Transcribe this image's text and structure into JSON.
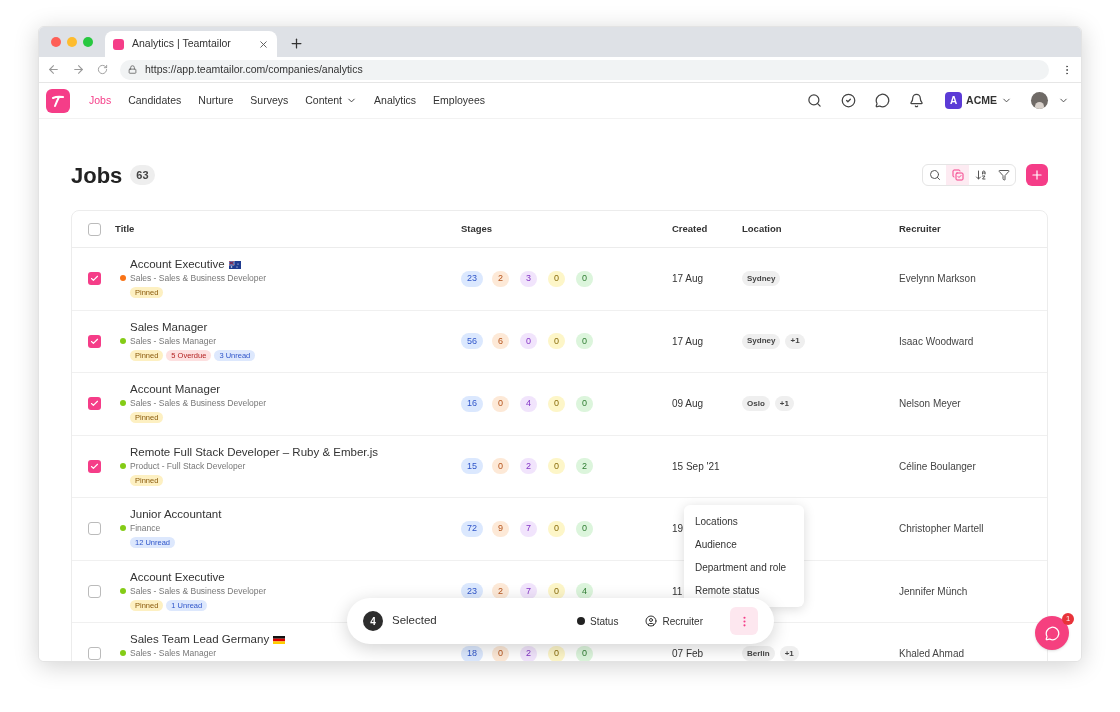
{
  "browser": {
    "tab_title": "Analytics | Teamtailor",
    "url": "https://app.teamtailor.com/companies/analytics"
  },
  "nav": {
    "items": [
      {
        "label": "Jobs",
        "selected": true,
        "dropdown": false
      },
      {
        "label": "Candidates",
        "selected": false,
        "dropdown": false
      },
      {
        "label": "Nurture",
        "selected": false,
        "dropdown": false
      },
      {
        "label": "Surveys",
        "selected": false,
        "dropdown": false
      },
      {
        "label": "Content",
        "selected": false,
        "dropdown": true
      },
      {
        "label": "Analytics",
        "selected": false,
        "dropdown": false
      },
      {
        "label": "Employees",
        "selected": false,
        "dropdown": false
      }
    ],
    "org_initial": "A",
    "org_name": "ACME"
  },
  "page": {
    "title": "Jobs",
    "count": "63"
  },
  "table": {
    "all_selected": false,
    "columns": [
      "Title",
      "Stages",
      "Created",
      "Location",
      "Recruiter"
    ],
    "rows": [
      {
        "checked": true,
        "color": "#f97316",
        "title": "Account Executive",
        "flag": {
          "kind": "au"
        },
        "subtitle": "Sales - Sales & Business Developer",
        "tags": [
          {
            "kind": "pinned",
            "label": "Pinned"
          }
        ],
        "stages": [
          {
            "count": "23",
            "color": "#dbe8fe"
          },
          {
            "count": "2",
            "color": "#fde9d7"
          },
          {
            "count": "3",
            "color": "#f1e4fc"
          },
          {
            "count": "0",
            "color": "#fdf6c8"
          },
          {
            "count": "0",
            "color": "#dcf5dc"
          }
        ],
        "created": "17 Aug",
        "locations": [
          "Sydney"
        ],
        "recruiter": "Evelynn Markson"
      },
      {
        "checked": true,
        "color": "#84cc16",
        "title": "Sales Manager",
        "subtitle": "Sales - Sales Manager",
        "tags": [
          {
            "kind": "pinned",
            "label": "Pinned"
          },
          {
            "kind": "overdue",
            "label": "5 Overdue"
          },
          {
            "kind": "unread",
            "label": "3 Unread"
          }
        ],
        "stages": [
          {
            "count": "56",
            "color": "#dbe8fe"
          },
          {
            "count": "6",
            "color": "#fde9d7"
          },
          {
            "count": "0",
            "color": "#f1e4fc"
          },
          {
            "count": "0",
            "color": "#fdf6c8"
          },
          {
            "count": "0",
            "color": "#dcf5dc"
          }
        ],
        "created": "17 Aug",
        "locations": [
          "Sydney",
          "+1"
        ],
        "recruiter": "Isaac Woodward"
      },
      {
        "checked": true,
        "color": "#84cc16",
        "title": "Account Manager",
        "subtitle": "Sales - Sales & Business Developer",
        "tags": [
          {
            "kind": "pinned",
            "label": "Pinned"
          }
        ],
        "stages": [
          {
            "count": "16",
            "color": "#dbe8fe"
          },
          {
            "count": "0",
            "color": "#fde9d7"
          },
          {
            "count": "4",
            "color": "#f1e4fc"
          },
          {
            "count": "0",
            "color": "#fdf6c8"
          },
          {
            "count": "0",
            "color": "#dcf5dc"
          }
        ],
        "created": "09 Aug",
        "locations": [
          "Oslo",
          "+1"
        ],
        "recruiter": "Nelson Meyer"
      },
      {
        "checked": true,
        "color": "#84cc16",
        "title": "Remote Full Stack Developer – Ruby & Ember.js",
        "subtitle": "Product - Full Stack Developer",
        "tags": [
          {
            "kind": "pinned",
            "label": "Pinned"
          }
        ],
        "stages": [
          {
            "count": "15",
            "color": "#dbe8fe"
          },
          {
            "count": "0",
            "color": "#fde9d7"
          },
          {
            "count": "2",
            "color": "#f1e4fc"
          },
          {
            "count": "0",
            "color": "#fdf6c8"
          },
          {
            "count": "2",
            "color": "#dcf5dc"
          }
        ],
        "created": "15 Sep '21",
        "recruiter": "Céline Boulanger"
      },
      {
        "checked": false,
        "color": "#84cc16",
        "title": "Junior Accountant",
        "subtitle": "Finance",
        "tags": [
          {
            "kind": "unread",
            "label": "12 Unread"
          }
        ],
        "stages": [
          {
            "count": "72",
            "color": "#dbe8fe"
          },
          {
            "count": "9",
            "color": "#fde9d7"
          },
          {
            "count": "7",
            "color": "#f1e4fc"
          },
          {
            "count": "0",
            "color": "#fdf6c8"
          },
          {
            "count": "0",
            "color": "#dcf5dc"
          }
        ],
        "created": "19",
        "recruiter": "Christopher Martell"
      },
      {
        "checked": false,
        "color": "#84cc16",
        "title": "Account Executive",
        "subtitle": "Sales - Sales & Business Developer",
        "tags": [
          {
            "kind": "pinned",
            "label": "Pinned"
          },
          {
            "kind": "unread",
            "label": "1 Unread"
          }
        ],
        "stages": [
          {
            "count": "23",
            "color": "#dbe8fe"
          },
          {
            "count": "2",
            "color": "#fde9d7"
          },
          {
            "count": "7",
            "color": "#f1e4fc"
          },
          {
            "count": "0",
            "color": "#fdf6c8"
          },
          {
            "count": "4",
            "color": "#dcf5dc"
          }
        ],
        "created": "11",
        "recruiter": "Jennifer Münch"
      },
      {
        "checked": false,
        "color": "#84cc16",
        "title": "Sales Team Lead Germany",
        "flag": {
          "kind": "de"
        },
        "subtitle": "Sales - Sales Manager",
        "stages": [
          {
            "count": "18",
            "color": "#dbe8fe"
          },
          {
            "count": "0",
            "color": "#fde9d7"
          },
          {
            "count": "2",
            "color": "#f1e4fc"
          },
          {
            "count": "0",
            "color": "#fdf6c8"
          },
          {
            "count": "0",
            "color": "#dcf5dc"
          }
        ],
        "created": "07 Feb",
        "locations": [
          "Berlin",
          "+1"
        ],
        "recruiter": "Khaled Ahmad"
      }
    ]
  },
  "selection_bar": {
    "count": "4",
    "label": "Selected",
    "actions": [
      {
        "kind": "status",
        "label": "Status"
      },
      {
        "kind": "recruiter",
        "label": "Recruiter"
      }
    ]
  },
  "menu": {
    "items": [
      "Locations",
      "Audience",
      "Department and role",
      "Remote status"
    ]
  },
  "chat": {
    "badge": "1"
  }
}
